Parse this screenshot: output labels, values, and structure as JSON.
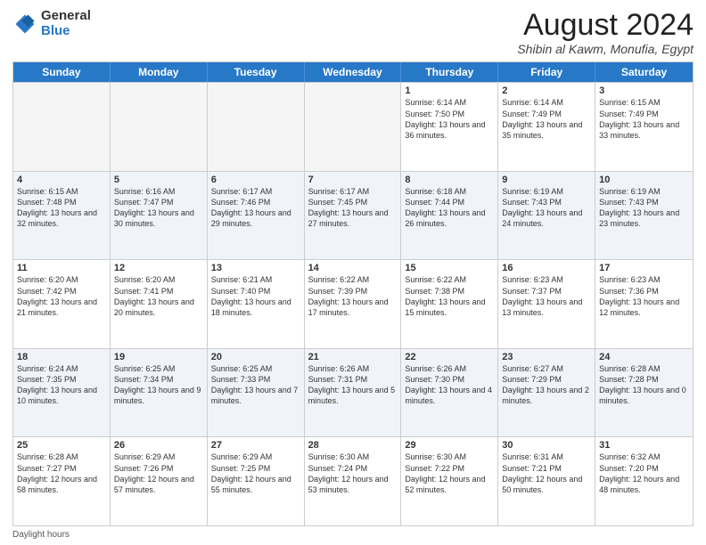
{
  "logo": {
    "general": "General",
    "blue": "Blue"
  },
  "title": "August 2024",
  "subtitle": "Shibin al Kawm, Monufia, Egypt",
  "days": [
    "Sunday",
    "Monday",
    "Tuesday",
    "Wednesday",
    "Thursday",
    "Friday",
    "Saturday"
  ],
  "weeks": [
    [
      {
        "day": "",
        "info": ""
      },
      {
        "day": "",
        "info": ""
      },
      {
        "day": "",
        "info": ""
      },
      {
        "day": "",
        "info": ""
      },
      {
        "day": "1",
        "info": "Sunrise: 6:14 AM\nSunset: 7:50 PM\nDaylight: 13 hours and 36 minutes."
      },
      {
        "day": "2",
        "info": "Sunrise: 6:14 AM\nSunset: 7:49 PM\nDaylight: 13 hours and 35 minutes."
      },
      {
        "day": "3",
        "info": "Sunrise: 6:15 AM\nSunset: 7:49 PM\nDaylight: 13 hours and 33 minutes."
      }
    ],
    [
      {
        "day": "4",
        "info": "Sunrise: 6:15 AM\nSunset: 7:48 PM\nDaylight: 13 hours and 32 minutes."
      },
      {
        "day": "5",
        "info": "Sunrise: 6:16 AM\nSunset: 7:47 PM\nDaylight: 13 hours and 30 minutes."
      },
      {
        "day": "6",
        "info": "Sunrise: 6:17 AM\nSunset: 7:46 PM\nDaylight: 13 hours and 29 minutes."
      },
      {
        "day": "7",
        "info": "Sunrise: 6:17 AM\nSunset: 7:45 PM\nDaylight: 13 hours and 27 minutes."
      },
      {
        "day": "8",
        "info": "Sunrise: 6:18 AM\nSunset: 7:44 PM\nDaylight: 13 hours and 26 minutes."
      },
      {
        "day": "9",
        "info": "Sunrise: 6:19 AM\nSunset: 7:43 PM\nDaylight: 13 hours and 24 minutes."
      },
      {
        "day": "10",
        "info": "Sunrise: 6:19 AM\nSunset: 7:43 PM\nDaylight: 13 hours and 23 minutes."
      }
    ],
    [
      {
        "day": "11",
        "info": "Sunrise: 6:20 AM\nSunset: 7:42 PM\nDaylight: 13 hours and 21 minutes."
      },
      {
        "day": "12",
        "info": "Sunrise: 6:20 AM\nSunset: 7:41 PM\nDaylight: 13 hours and 20 minutes."
      },
      {
        "day": "13",
        "info": "Sunrise: 6:21 AM\nSunset: 7:40 PM\nDaylight: 13 hours and 18 minutes."
      },
      {
        "day": "14",
        "info": "Sunrise: 6:22 AM\nSunset: 7:39 PM\nDaylight: 13 hours and 17 minutes."
      },
      {
        "day": "15",
        "info": "Sunrise: 6:22 AM\nSunset: 7:38 PM\nDaylight: 13 hours and 15 minutes."
      },
      {
        "day": "16",
        "info": "Sunrise: 6:23 AM\nSunset: 7:37 PM\nDaylight: 13 hours and 13 minutes."
      },
      {
        "day": "17",
        "info": "Sunrise: 6:23 AM\nSunset: 7:36 PM\nDaylight: 13 hours and 12 minutes."
      }
    ],
    [
      {
        "day": "18",
        "info": "Sunrise: 6:24 AM\nSunset: 7:35 PM\nDaylight: 13 hours and 10 minutes."
      },
      {
        "day": "19",
        "info": "Sunrise: 6:25 AM\nSunset: 7:34 PM\nDaylight: 13 hours and 9 minutes."
      },
      {
        "day": "20",
        "info": "Sunrise: 6:25 AM\nSunset: 7:33 PM\nDaylight: 13 hours and 7 minutes."
      },
      {
        "day": "21",
        "info": "Sunrise: 6:26 AM\nSunset: 7:31 PM\nDaylight: 13 hours and 5 minutes."
      },
      {
        "day": "22",
        "info": "Sunrise: 6:26 AM\nSunset: 7:30 PM\nDaylight: 13 hours and 4 minutes."
      },
      {
        "day": "23",
        "info": "Sunrise: 6:27 AM\nSunset: 7:29 PM\nDaylight: 13 hours and 2 minutes."
      },
      {
        "day": "24",
        "info": "Sunrise: 6:28 AM\nSunset: 7:28 PM\nDaylight: 13 hours and 0 minutes."
      }
    ],
    [
      {
        "day": "25",
        "info": "Sunrise: 6:28 AM\nSunset: 7:27 PM\nDaylight: 12 hours and 58 minutes."
      },
      {
        "day": "26",
        "info": "Sunrise: 6:29 AM\nSunset: 7:26 PM\nDaylight: 12 hours and 57 minutes."
      },
      {
        "day": "27",
        "info": "Sunrise: 6:29 AM\nSunset: 7:25 PM\nDaylight: 12 hours and 55 minutes."
      },
      {
        "day": "28",
        "info": "Sunrise: 6:30 AM\nSunset: 7:24 PM\nDaylight: 12 hours and 53 minutes."
      },
      {
        "day": "29",
        "info": "Sunrise: 6:30 AM\nSunset: 7:22 PM\nDaylight: 12 hours and 52 minutes."
      },
      {
        "day": "30",
        "info": "Sunrise: 6:31 AM\nSunset: 7:21 PM\nDaylight: 12 hours and 50 minutes."
      },
      {
        "day": "31",
        "info": "Sunrise: 6:32 AM\nSunset: 7:20 PM\nDaylight: 12 hours and 48 minutes."
      }
    ]
  ],
  "footer": {
    "daylight_label": "Daylight hours"
  }
}
